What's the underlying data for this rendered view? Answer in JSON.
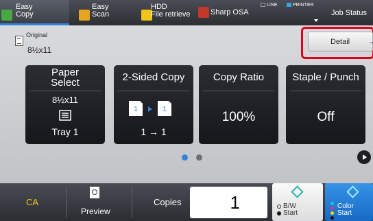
{
  "modes": [
    {
      "l1": "Easy",
      "l2": "Copy",
      "icon": "copy-icon",
      "color": "#4aa842"
    },
    {
      "l1": "Easy",
      "l2": "Scan",
      "icon": "scan-icon",
      "color": "#e8a320"
    },
    {
      "l1": "HDD",
      "l2": "File retrieve",
      "icon": "folder-icon",
      "color": "#f0c419"
    },
    {
      "l1": "Sharp OSA",
      "l2": "",
      "icon": "osa-icon",
      "color": "#c0392b"
    }
  ],
  "indicators": {
    "line": "LINE",
    "printer": "PRINTER"
  },
  "job_status": "Job Status",
  "original": {
    "label": "Original",
    "value": "8½x11"
  },
  "detail": {
    "label": "Detail",
    "arrow": "→"
  },
  "tiles": [
    {
      "title_l1": "Paper",
      "title_l2": "Select",
      "value": "8½x11",
      "sub": "Tray 1"
    },
    {
      "title": "2-Sided Copy",
      "sub": "1 → 1"
    },
    {
      "title": "Copy Ratio",
      "value": "100%"
    },
    {
      "title": "Staple / Punch",
      "value": "Off"
    }
  ],
  "pager": {
    "pages": 2,
    "current": 1
  },
  "bottom": {
    "ca": "CA",
    "preview": "Preview",
    "copies_label": "Copies",
    "copies_value": "1",
    "bw_l1": "B/W",
    "bw_l2": "Start",
    "color_l1": "Color",
    "color_l2": "Start"
  },
  "colors": {
    "accent": "#2f84d8",
    "highlight": "#e2001a",
    "ca": "#f0c419",
    "color_start": "#1e7bd8"
  }
}
